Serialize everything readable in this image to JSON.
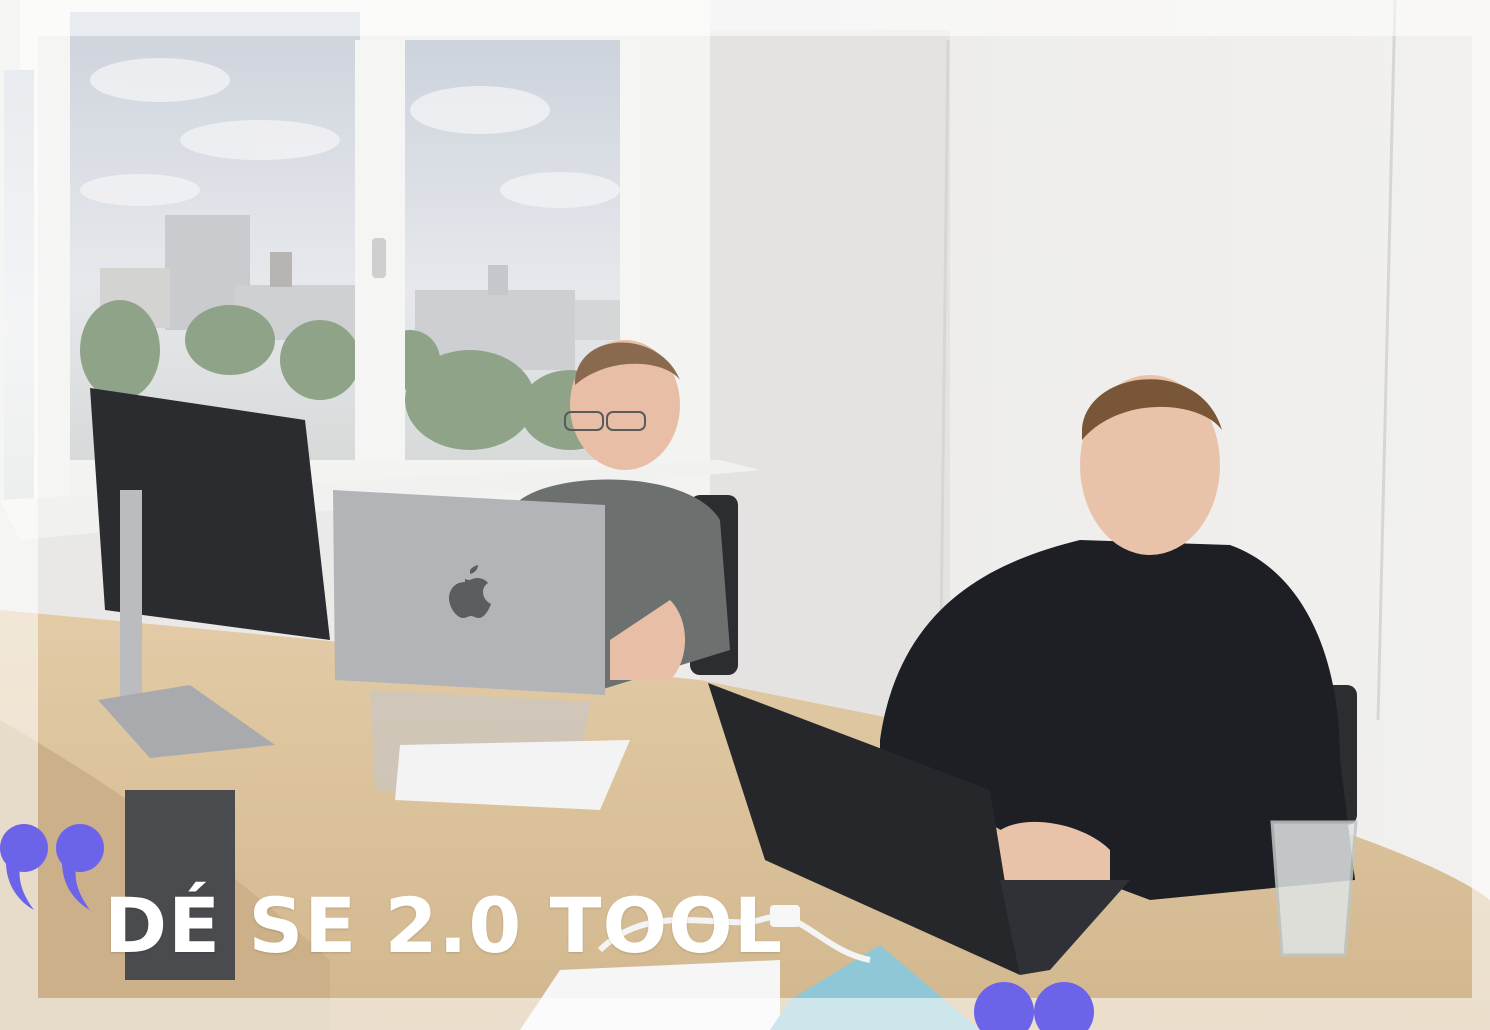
{
  "headline": "DÉ SE 2.0 TOOL",
  "colors": {
    "accent": "#6b63e8",
    "headline_text": "#ffffff",
    "desk": "#d9c09a",
    "wall": "#efeeec",
    "shirt_dark": "#1e1f24",
    "shirt_gray": "#6c706e",
    "laptop_silver": "#b3b4b8",
    "laptop_black": "#26272b"
  },
  "decorations": {
    "top_left_quote": "quote-mark-icon",
    "bottom_quote": "quote-mark-icon"
  }
}
